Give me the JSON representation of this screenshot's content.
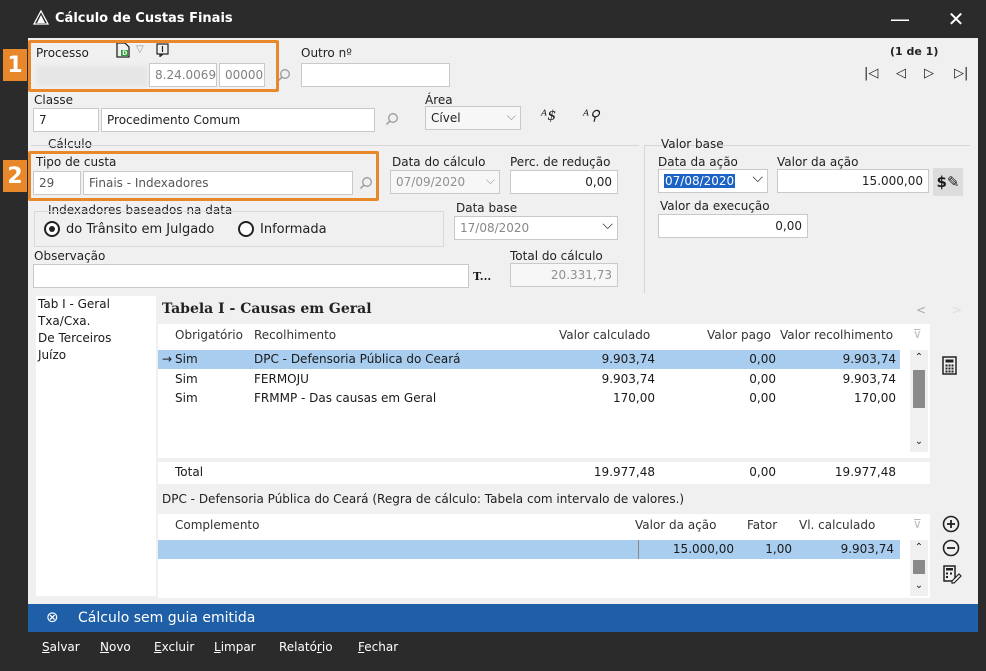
{
  "window": {
    "title": "Cálculo de Custas Finais",
    "minimize": "—",
    "close": "✕"
  },
  "header": {
    "processo_label": "Processo",
    "processo_num1": "8.24.0069",
    "processo_num2": "00000",
    "outro_label": "Outro nº",
    "pager": "(1 de 1)",
    "nav_first": "|◁",
    "nav_prev": "◁",
    "nav_next": "▷",
    "nav_last": "▷|"
  },
  "classe": {
    "label": "Classe",
    "code": "7",
    "name": "Procedimento Comum"
  },
  "area": {
    "label": "Área",
    "value": "Cível"
  },
  "calculo": {
    "group_label": "Cálculo",
    "tipo_label": "Tipo de custa",
    "tipo_code": "29",
    "tipo_name": "Finais - Indexadores",
    "data_calc_label": "Data do cálculo",
    "data_calc_value": "07/09/2020",
    "perc_label": "Perc. de redução",
    "perc_value": "0,00",
    "indexadores_label": "Indexadores baseados na data",
    "radio_transito": "do Trânsito em Julgado",
    "radio_informada": "Informada",
    "data_base_label": "Data base",
    "data_base_value": "17/08/2020",
    "obs_label": "Observação",
    "obs_btn": "T...",
    "total_label": "Total do cálculo",
    "total_value": "20.331,73"
  },
  "valor_base": {
    "group_label": "Valor base",
    "data_acao_label": "Data da ação",
    "data_acao_value": "07/08/2020",
    "valor_acao_label": "Valor da ação",
    "valor_acao_value": "15.000,00",
    "valor_exec_label": "Valor da execução",
    "valor_exec_value": "0,00"
  },
  "badges": {
    "one": "1",
    "two": "2"
  },
  "tabs": [
    "Tab I - Geral",
    "Txa/Cxa.",
    "De Terceiros",
    "Juízo"
  ],
  "tabela": {
    "title": "Tabela I - Causas em Geral",
    "prev": "<",
    "next": ">",
    "columns": {
      "obrigatorio": "Obrigatório",
      "recolhimento": "Recolhimento",
      "valor_calculado": "Valor calculado",
      "valor_pago": "Valor pago",
      "valor_recolhimento": "Valor recolhimento"
    },
    "rows": [
      {
        "marker": "→",
        "obrigatorio": "Sim",
        "recolhimento": "DPC - Defensoria Pública do Ceará",
        "valor_calculado": "9.903,74",
        "valor_pago": "0,00",
        "valor_recolhimento": "9.903,74"
      },
      {
        "marker": "",
        "obrigatorio": "Sim",
        "recolhimento": "FERMOJU",
        "valor_calculado": "9.903,74",
        "valor_pago": "0,00",
        "valor_recolhimento": "9.903,74"
      },
      {
        "marker": "",
        "obrigatorio": "Sim",
        "recolhimento": "FRMMP - Das causas em Geral",
        "valor_calculado": "170,00",
        "valor_pago": "0,00",
        "valor_recolhimento": "170,00"
      }
    ],
    "total_label": "Total",
    "total_calculado": "19.977,48",
    "total_pago": "0,00",
    "total_recolhimento": "19.977,48"
  },
  "detalhe": {
    "description": "DPC - Defensoria Pública do Ceará (Regra de cálculo: Tabela com intervalo de valores.)",
    "columns": {
      "complemento": "Complemento",
      "valor_acao": "Valor da ação",
      "fator": "Fator",
      "vl_calculado": "Vl. calculado"
    },
    "rows": [
      {
        "complemento": "",
        "valor_acao": "15.000,00",
        "fator": "1,00",
        "vl_calculado": "9.903,74"
      }
    ]
  },
  "status": {
    "icon": "⊗",
    "text": "Cálculo sem guia emitida"
  },
  "menu": {
    "salvar_first": "S",
    "salvar_rest": "alvar",
    "novo_first": "N",
    "novo_rest": "ovo",
    "excluir_first": "E",
    "excluir_rest": "xcluir",
    "limpar_first": "L",
    "limpar_rest": "impar",
    "relatorio_pre": "Relató",
    "relatorio_u": "r",
    "relatorio_post": "io",
    "fechar_first": "F",
    "fechar_rest": "echar"
  },
  "colors": {
    "accent_orange": "#e8882b",
    "status_blue": "#1f5fa8",
    "titlebar": "#2b2b2b",
    "selection": "#a9cdee"
  }
}
